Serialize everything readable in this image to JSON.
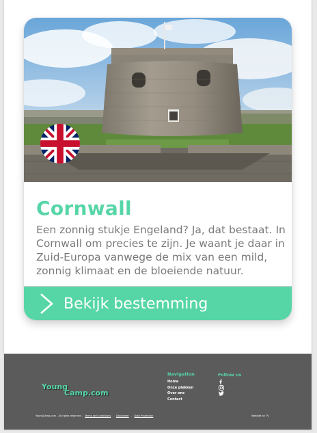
{
  "card": {
    "title": "Cornwall",
    "description": "Een zonnig stukje Engeland? Ja, dat bestaat. In Cornwall om precies te zijn. Je waant je daar in Zuid-Europa vanwege de mix van een mild, zonnig klimaat en de bloeiende natuur.",
    "cta_label": "Bekijk bestemming",
    "flag_icon": "uk-flag-icon"
  },
  "footer": {
    "logo_part1": "Young",
    "logo_part2": "Camp.com",
    "nav_heading": "Navigation",
    "nav_items": [
      "Home",
      "Onze plekken",
      "Over ons",
      "Contact"
    ],
    "follow_heading": "Follow us",
    "social_icons": [
      "facebook-icon",
      "instagram-icon",
      "twitter-icon"
    ],
    "legal_text": "YoungCamp.com - All rights reserved -",
    "legal_links": [
      "Terms and conditions",
      "Disclaimer",
      "Data Protection"
    ],
    "credit": "Website by TV"
  },
  "colors": {
    "accent": "#56d6a7",
    "footer_bg": "#5b5b5b",
    "text_muted": "#7a7a7a"
  }
}
